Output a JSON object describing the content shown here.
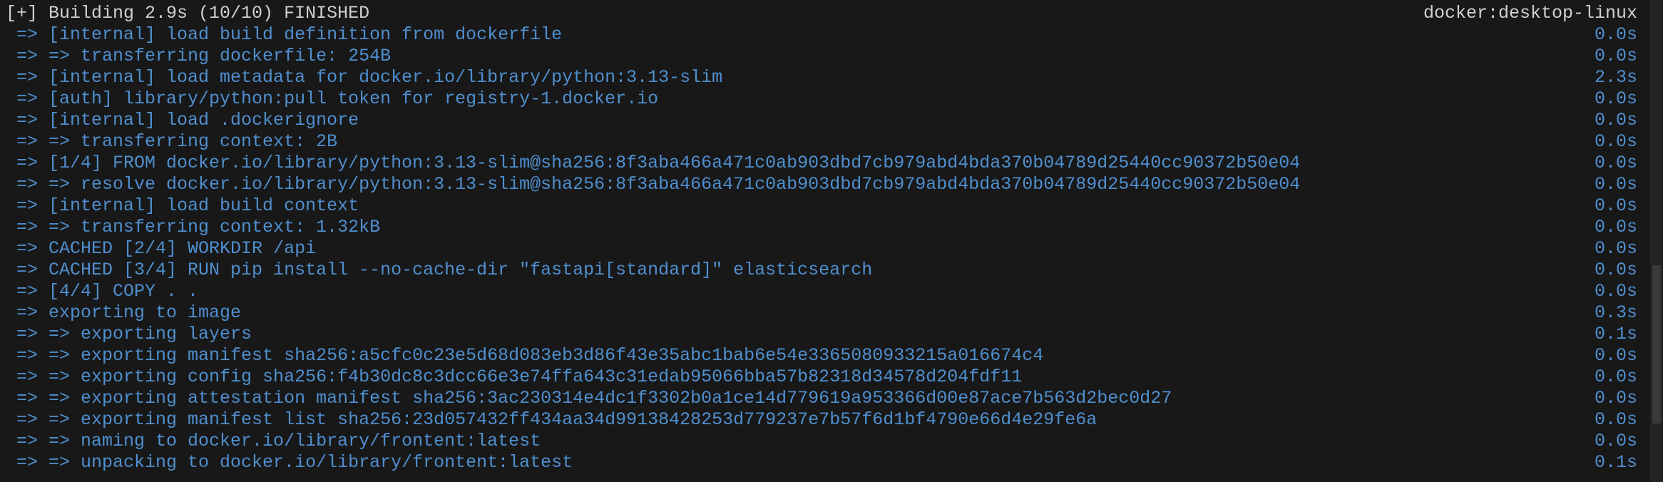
{
  "header": {
    "left": "[+] Building 2.9s (10/10) FINISHED",
    "right": "docker:desktop-linux"
  },
  "lines": [
    {
      "text": " => [internal] load build definition from dockerfile",
      "time": "0.0s"
    },
    {
      "text": " => => transferring dockerfile: 254B",
      "time": "0.0s"
    },
    {
      "text": " => [internal] load metadata for docker.io/library/python:3.13-slim",
      "time": "2.3s"
    },
    {
      "text": " => [auth] library/python:pull token for registry-1.docker.io",
      "time": "0.0s"
    },
    {
      "text": " => [internal] load .dockerignore",
      "time": "0.0s"
    },
    {
      "text": " => => transferring context: 2B",
      "time": "0.0s"
    },
    {
      "text": " => [1/4] FROM docker.io/library/python:3.13-slim@sha256:8f3aba466a471c0ab903dbd7cb979abd4bda370b04789d25440cc90372b50e04",
      "time": "0.0s"
    },
    {
      "text": " => => resolve docker.io/library/python:3.13-slim@sha256:8f3aba466a471c0ab903dbd7cb979abd4bda370b04789d25440cc90372b50e04",
      "time": "0.0s"
    },
    {
      "text": " => [internal] load build context",
      "time": "0.0s"
    },
    {
      "text": " => => transferring context: 1.32kB",
      "time": "0.0s"
    },
    {
      "text": " => CACHED [2/4] WORKDIR /api",
      "time": "0.0s"
    },
    {
      "text": " => CACHED [3/4] RUN pip install --no-cache-dir \"fastapi[standard]\" elasticsearch",
      "time": "0.0s"
    },
    {
      "text": " => [4/4] COPY . .",
      "time": "0.0s"
    },
    {
      "text": " => exporting to image",
      "time": "0.3s"
    },
    {
      "text": " => => exporting layers",
      "time": "0.1s"
    },
    {
      "text": " => => exporting manifest sha256:a5cfc0c23e5d68d083eb3d86f43e35abc1bab6e54e3365080933215a016674c4",
      "time": "0.0s"
    },
    {
      "text": " => => exporting config sha256:f4b30dc8c3dcc66e3e74ffa643c31edab95066bba57b82318d34578d204fdf11",
      "time": "0.0s"
    },
    {
      "text": " => => exporting attestation manifest sha256:3ac230314e4dc1f3302b0a1ce14d779619a953366d00e87ace7b563d2bec0d27",
      "time": "0.0s"
    },
    {
      "text": " => => exporting manifest list sha256:23d057432ff434aa34d99138428253d779237e7b57f6d1bf4790e66d4e29fe6a",
      "time": "0.0s"
    },
    {
      "text": " => => naming to docker.io/library/frontent:latest",
      "time": "0.0s"
    },
    {
      "text": " => => unpacking to docker.io/library/frontent:latest",
      "time": "0.1s"
    }
  ]
}
